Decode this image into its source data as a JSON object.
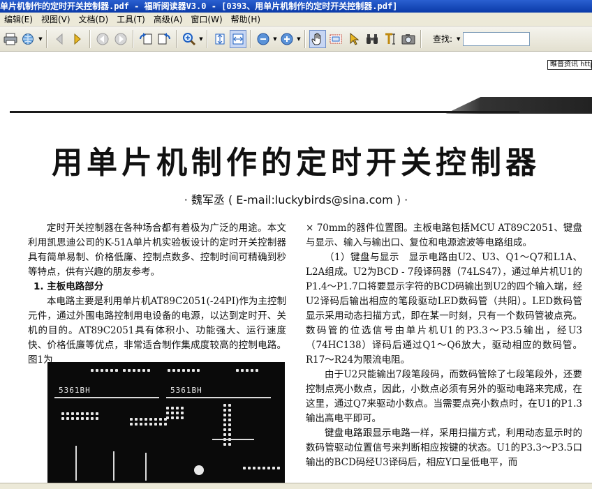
{
  "window": {
    "title": "单片机制作的定时开关控制器.pdf - 福昕阅读器V3.0 - [0393、用单片机制作的定时开关控制器.pdf]"
  },
  "menu": {
    "items": [
      "编辑(E)",
      "视图(V)",
      "文档(D)",
      "工具(T)",
      "高级(A)",
      "窗口(W)",
      "帮助(H)"
    ]
  },
  "toolbar": {
    "find_label": "查找:",
    "find_value": ""
  },
  "document": {
    "side_note": "睢普资讯 http://",
    "title": "用单片机制作的定时开关控制器",
    "byline": "· 魏军丞 ( E-mail:luckybirds@sina.com ) ·",
    "left_column": {
      "intro": "定时开关控制器在各种场合都有着极为广泛的用途。本文利用凯思迪公司的K-51A单片机实验板设计的定时开关控制器具有简单易制、价格低廉、控制点数多、控制时间可精确到秒等特点，供有兴趣的朋友参考。",
      "section1": "1. 主板电路部分",
      "section1_body": "本电路主要是利用单片机AT89C2051(-24PI)作为主控制元件，通过外围电路控制用电设备的电源，以达到定时开、关机的目的。AT89C2051具有体积小、功能强大、运行速度快、价格低廉等优点，非常适合制作集成度较高的控制电路。图1为"
    },
    "right_column": {
      "p1": "× 70mm的器件位置图。主板电路包括MCU AT89C2051、键盘与显示、输入与输出口、复位和电源滤波等电路组成。",
      "p2": "（1）键盘与显示　显示电路由U2、U3、Q1～Q7和L1A、L2A组成。U2为BCD - 7段译码器（74LS47），通过单片机U1的P1.4～P1.7口将要显示字符的BCD码输出到U2的四个输入端，经U2译码后输出相应的笔段驱动LED数码管（共阳）。LED数码管显示采用动态扫描方式，即在某一时刻，只有一个数码管被点亮。数码管的位选信号由单片机U1的P3.3～P3.5输出，经U3（74HC138）译码后通过Q1～Q6放大，驱动相应的数码管。R17～R24为限流电阻。",
      "p3": "由于U2只能输出7段笔段码，而数码管除了七段笔段外，还要控制点亮小数点，因此，小数点必须有另外的驱动电路来完成，在这里，通过Q7来驱动小数点。当需要点亮小数点时，在U1的P1.3输出高电平即可。",
      "p4": "键盘电路跟显示电路一样，采用扫描方式，利用动态显示时的数码管驱动位置信号来判断相应按键的状态。U1的P3.3～P3.5口输出的BCD码经U3译码后，相应Y口呈低电平，而"
    },
    "figure": {
      "label_left": "5361BH",
      "label_right": "5361BH"
    }
  }
}
